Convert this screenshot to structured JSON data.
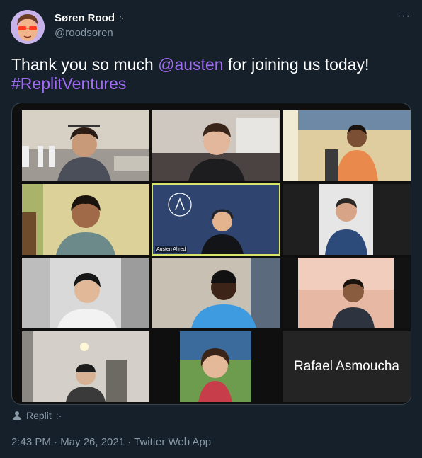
{
  "author": {
    "display_name": "Søren Rood",
    "name_badge": ":·",
    "handle": "@roodsoren"
  },
  "menu": {
    "more_label": "···"
  },
  "tweet": {
    "text_1": "Thank you so much ",
    "mention": "@austen",
    "text_2": " for joining us today!",
    "hashtag": "#ReplitVentures"
  },
  "video_call": {
    "tiles": [
      {
        "label": ""
      },
      {
        "label": ""
      },
      {
        "label": ""
      },
      {
        "label": ""
      },
      {
        "label": "Austen Allred"
      },
      {
        "label": ""
      },
      {
        "label": ""
      },
      {
        "label": ""
      },
      {
        "label": ""
      },
      {
        "label": ""
      },
      {
        "label": ""
      },
      {
        "label": "Rafael Asmoucha"
      }
    ]
  },
  "retweet_context": {
    "label": "Replit",
    "badge": ":·"
  },
  "meta": {
    "timestamp": "2:43 PM · May 26, 2021 · Twitter Web App"
  },
  "colors": {
    "background": "#15202b",
    "link": "#9f6cf2",
    "secondary_text": "#8899a6",
    "active_speaker_border": "#d9e36a"
  }
}
